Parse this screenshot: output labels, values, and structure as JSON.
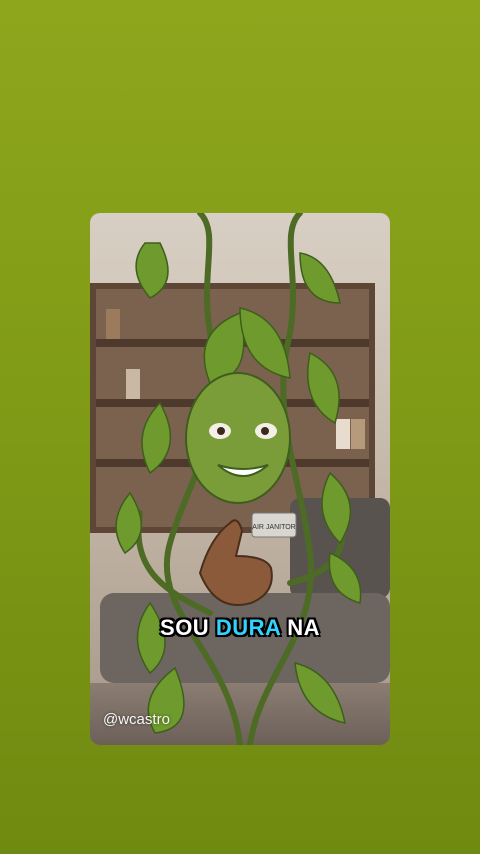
{
  "video": {
    "caption_words": [
      {
        "text": "SOU",
        "highlight": false
      },
      {
        "text": "DURA",
        "highlight": true
      },
      {
        "text": "NA",
        "highlight": false
      }
    ],
    "badge_text": "AIR JANITOR",
    "watermark": "@wcastro"
  },
  "colors": {
    "background": "#8ea61c",
    "caption": "#ffffff",
    "caption_highlight": "#33d3ff"
  }
}
